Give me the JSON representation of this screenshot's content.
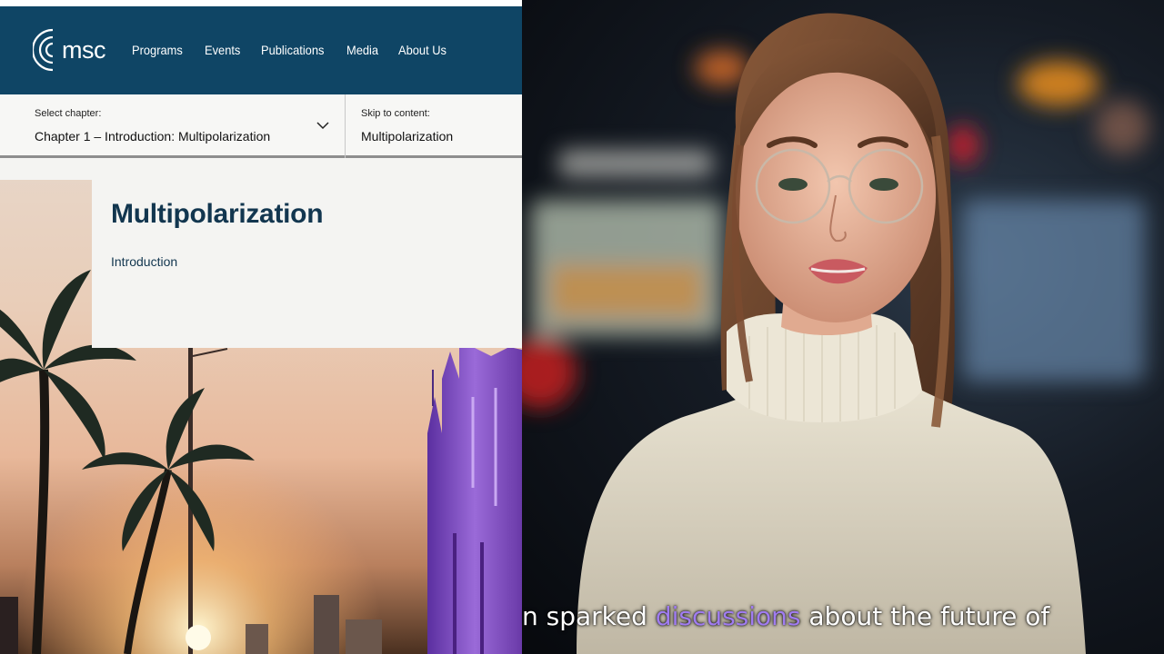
{
  "site": {
    "logo_text": "msc",
    "nav": [
      "Programs",
      "Events",
      "Publications",
      "Media",
      "About Us"
    ],
    "chapter_select": {
      "label": "Select chapter:",
      "value": "Chapter 1 – Introduction: Multipolarization"
    },
    "skip_to_content": {
      "label": "Skip to content:",
      "value": "Multipolarization"
    },
    "hero": {
      "title": "Multipolarization",
      "subtitle": "Introduction"
    },
    "colors": {
      "navbar": "#0f4565",
      "title": "#12364f"
    }
  },
  "video": {
    "caption": {
      "before": "n sparked ",
      "highlight": "discussions",
      "after": " about the future of"
    },
    "highlight_color": "#a07cf0"
  }
}
